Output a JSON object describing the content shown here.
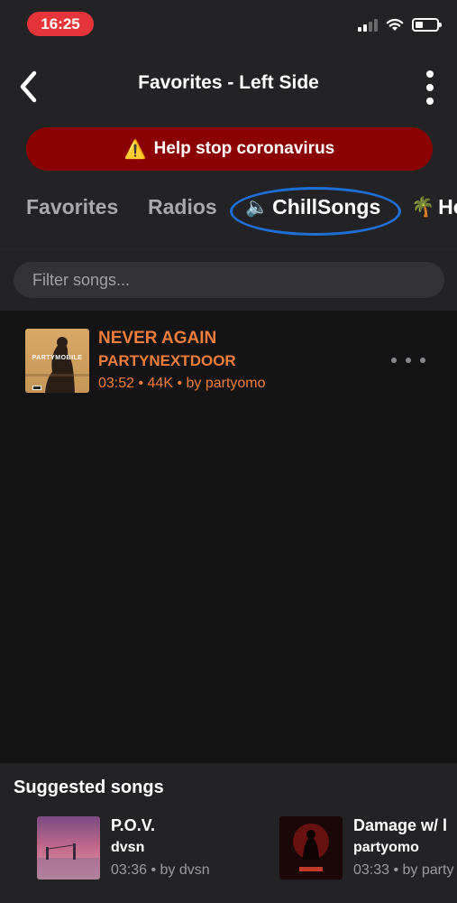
{
  "status_bar": {
    "time": "16:25"
  },
  "header": {
    "title": "Favorites - Left Side"
  },
  "banner": {
    "icon": "⚠️",
    "text": "Help stop coronavirus"
  },
  "tabs": [
    {
      "label": "Favorites",
      "emoji": ""
    },
    {
      "label": "Radios",
      "emoji": ""
    },
    {
      "label": "ChillSongs",
      "emoji": "🔈",
      "selected": true
    },
    {
      "label": "Ho",
      "emoji": "🌴"
    }
  ],
  "filter": {
    "placeholder": "Filter songs..."
  },
  "songs": [
    {
      "title": "NEVER AGAIN",
      "artist": "PARTYNEXTDOOR",
      "meta": "03:52 • 44K • by partyomo",
      "cover_text": "PARTYMOBILE"
    }
  ],
  "suggested": {
    "title": "Suggested songs",
    "items": [
      {
        "title": "P.O.V.",
        "artist": "dvsn",
        "meta": "03:36 • by dvsn"
      },
      {
        "title": "Damage w/ l",
        "artist": "partyomo",
        "meta": "03:33 • by party"
      }
    ]
  },
  "colors": {
    "background": "#141414",
    "header": "#232325",
    "accent": "#ef7d3c",
    "banner": "#8b0000",
    "time_pill": "#e5353a",
    "tab_highlight": "#1f6fd6"
  }
}
